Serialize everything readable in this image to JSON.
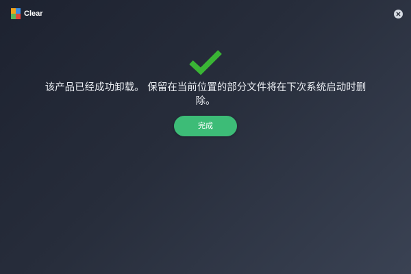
{
  "window": {
    "title": "Clear",
    "logo_icon": "app-logo-icon",
    "close_icon": "close-icon"
  },
  "main": {
    "status_icon": "checkmark-icon",
    "message": "该产品已经成功卸载。 保留在当前位置的部分文件将在下次系统启动时删除。",
    "done_button_label": "完成"
  },
  "colors": {
    "background_start": "#1d2230",
    "background_end": "#3a4253",
    "accent_green": "#3dbc77",
    "check_green": "#3ab535"
  }
}
